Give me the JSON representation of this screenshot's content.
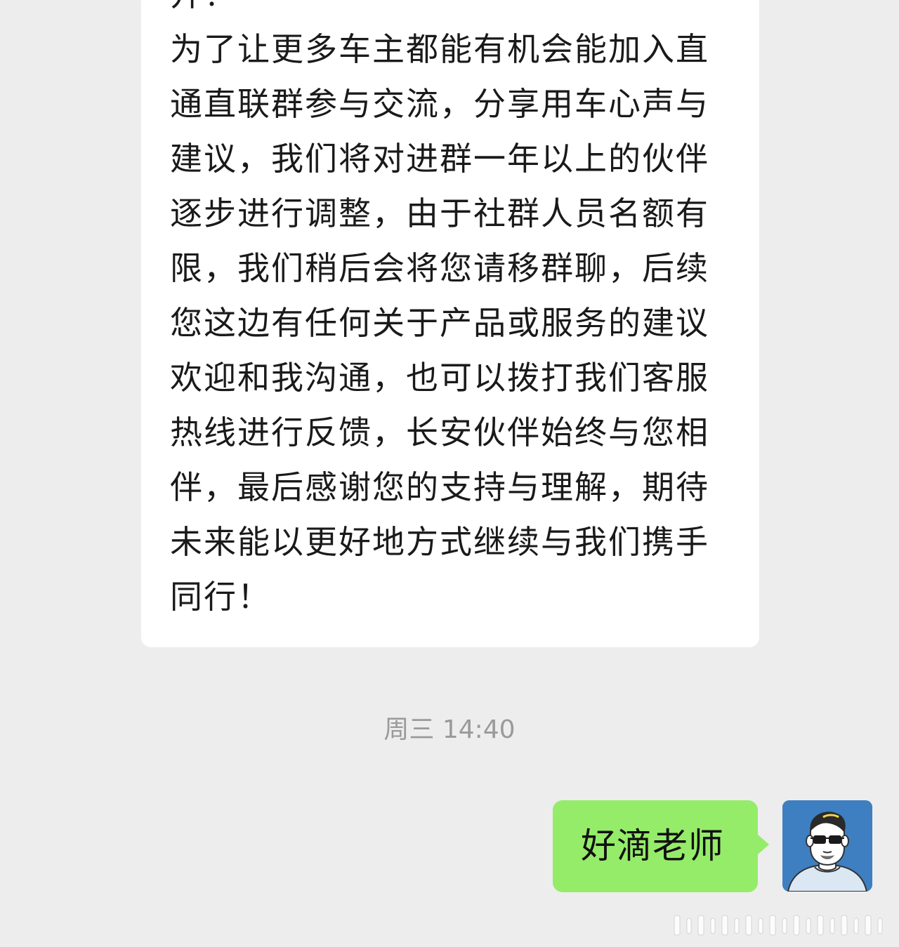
{
  "conversation": {
    "incoming_message": "开！\n为了让更多车主都能有机会能加入直通直联群参与交流，分享用车心声与建议，我们将对进群一年以上的伙伴逐步进行调整，由于社群人员名额有限，我们稍后会将您请移群聊，后续您这边有任何关于产品或服务的建议欢迎和我沟通，也可以拨打我们客服热线进行反馈，长安伙伴始终与您相伴，最后感谢您的支持与理解，期待未来能以更好地方式继续与我们携手同行！",
    "timestamp": "周三 14:40",
    "outgoing_message": "好滴老师"
  },
  "colors": {
    "background": "#ededed",
    "incoming_bubble": "#ffffff",
    "outgoing_bubble": "#95ec69",
    "timestamp_text": "#9a9a9a",
    "avatar_background": "#3e7fc1"
  },
  "icons": {
    "avatar": "cartoon-man-with-sunglasses-avatar",
    "watermark": "barcode-watermark"
  }
}
